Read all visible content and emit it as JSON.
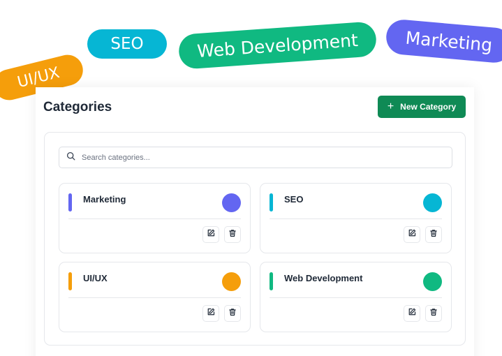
{
  "floating_tags": [
    {
      "label": "UI/UX",
      "color": "#f59e0b"
    },
    {
      "label": "SEO",
      "color": "#06b6d4"
    },
    {
      "label": "Web Development",
      "color": "#10b981"
    },
    {
      "label": "Marketing",
      "color": "#6366f1"
    }
  ],
  "header": {
    "title": "Categories",
    "new_button_label": "New Category",
    "new_button_color": "#0f8a55"
  },
  "search": {
    "placeholder": "Search categories...",
    "value": ""
  },
  "categories": [
    {
      "name": "Marketing",
      "color": "#6366f1"
    },
    {
      "name": "SEO",
      "color": "#06b6d4"
    },
    {
      "name": "UI/UX",
      "color": "#f59e0b"
    },
    {
      "name": "Web Development",
      "color": "#10b981"
    }
  ],
  "icons": {
    "search": "search-icon",
    "plus": "plus-icon",
    "edit": "edit-icon",
    "delete": "trash-icon"
  }
}
